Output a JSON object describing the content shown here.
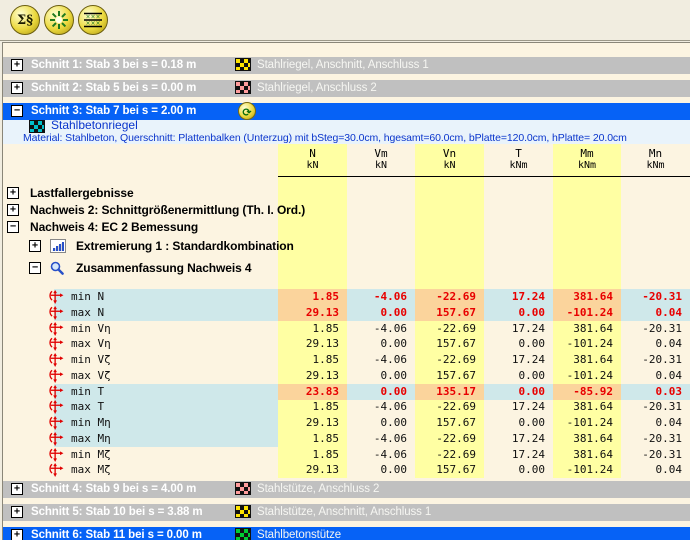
{
  "toolbar": {
    "buttons": [
      {
        "name": "sum-paragraph",
        "glyph": "Σ§"
      },
      {
        "name": "starburst",
        "glyph": ""
      },
      {
        "name": "value-table",
        "glyph": ""
      }
    ]
  },
  "sections": [
    {
      "label": "Schnitt 1: Stab 3 bei s = 0.18 m",
      "description": "Stahlriegel, Anschnitt, Anschluss 1",
      "checker": "yellow",
      "expanded": false,
      "selected": false
    },
    {
      "label": "Schnitt 2: Stab 5 bei s = 0.00 m",
      "description": "Stahlriegel, Anschluss 2",
      "checker": "pink",
      "expanded": false,
      "selected": false
    },
    {
      "label": "Schnitt 3: Stab 7 bei s = 2.00 m",
      "description": "",
      "checker": "none",
      "expanded": true,
      "selected": true
    },
    {
      "label": "Schnitt 4: Stab 9 bei s = 4.00 m",
      "description": "Stahlstütze, Anschluss 2",
      "checker": "pink",
      "expanded": false,
      "selected": false
    },
    {
      "label": "Schnitt 5: Stab 10 bei s = 3.88 m",
      "description": "Stahlstütze, Anschnitt, Anschluss 1",
      "checker": "yellow",
      "expanded": false,
      "selected": false
    },
    {
      "label": "Schnitt 6: Stab 11 bei s = 0.00 m",
      "description": "Stahlbetonstütze",
      "checker": "green",
      "expanded": false,
      "selected": true
    }
  ],
  "detail": {
    "member_label": "Stahlbetonriegel",
    "member_checker": "cyan",
    "material_line": "Material: Stahlbeton,  Querschnitt: Plattenbalken (Unterzug) mit bSteg=30.0cm, hgesamt=60.0cm, bPlatte=120.0cm, hPlatte= 20.0cm"
  },
  "tree": [
    {
      "label": "Lastfallergebnisse",
      "level": 0,
      "expanded": false,
      "icon": "none"
    },
    {
      "label": "Nachweis 2: Schnittgrößenermittlung (Th. I. Ord.)",
      "level": 0,
      "expanded": false,
      "icon": "none"
    },
    {
      "label": "Nachweis 4: EC 2 Bemessung",
      "level": 0,
      "expanded": true,
      "icon": "none"
    },
    {
      "label": "Extremierung 1 : Standardkombination",
      "level": 1,
      "expanded": false,
      "icon": "bar-chart"
    },
    {
      "label": "Zusammenfassung Nachweis 4",
      "level": 1,
      "expanded": true,
      "icon": "magnifier"
    }
  ],
  "table": {
    "columns": [
      {
        "name": "N",
        "unit": "kN",
        "band": true
      },
      {
        "name": "Vm",
        "unit": "kN",
        "band": false
      },
      {
        "name": "Vn",
        "unit": "kN",
        "band": true
      },
      {
        "name": "T",
        "unit": "kNm",
        "band": false
      },
      {
        "name": "Mm",
        "unit": "kNm",
        "band": true
      },
      {
        "name": "Mn",
        "unit": "kNm",
        "band": false
      }
    ],
    "rows": [
      {
        "label": "min N",
        "values": [
          "1.85",
          "-4.06",
          "-22.69",
          "17.24",
          "381.64",
          "-20.31"
        ],
        "highlight": "row"
      },
      {
        "label": "max N",
        "values": [
          "29.13",
          "0.00",
          "157.67",
          "0.00",
          "-101.24",
          "0.04"
        ],
        "highlight": "row"
      },
      {
        "label": "min Vη",
        "values": [
          "1.85",
          "-4.06",
          "-22.69",
          "17.24",
          "381.64",
          "-20.31"
        ],
        "highlight": "none"
      },
      {
        "label": "max Vη",
        "values": [
          "29.13",
          "0.00",
          "157.67",
          "0.00",
          "-101.24",
          "0.04"
        ],
        "highlight": "none"
      },
      {
        "label": "min Vζ",
        "values": [
          "1.85",
          "-4.06",
          "-22.69",
          "17.24",
          "381.64",
          "-20.31"
        ],
        "highlight": "none"
      },
      {
        "label": "max Vζ",
        "values": [
          "29.13",
          "0.00",
          "157.67",
          "0.00",
          "-101.24",
          "0.04"
        ],
        "highlight": "none"
      },
      {
        "label": "min T",
        "values": [
          "23.83",
          "0.00",
          "135.17",
          "0.00",
          "-85.92",
          "0.03"
        ],
        "highlight": "row"
      },
      {
        "label": "max T",
        "values": [
          "1.85",
          "-4.06",
          "-22.69",
          "17.24",
          "381.64",
          "-20.31"
        ],
        "highlight": "label"
      },
      {
        "label": "min Mη",
        "values": [
          "29.13",
          "0.00",
          "157.67",
          "0.00",
          "-101.24",
          "0.04"
        ],
        "highlight": "label"
      },
      {
        "label": "max Mη",
        "values": [
          "1.85",
          "-4.06",
          "-22.69",
          "17.24",
          "381.64",
          "-20.31"
        ],
        "highlight": "label"
      },
      {
        "label": "min Mζ",
        "values": [
          "1.85",
          "-4.06",
          "-22.69",
          "17.24",
          "381.64",
          "-20.31"
        ],
        "highlight": "none"
      },
      {
        "label": "max Mζ",
        "values": [
          "29.13",
          "0.00",
          "157.67",
          "0.00",
          "-101.24",
          "0.04"
        ],
        "highlight": "none"
      }
    ]
  },
  "colors": {
    "panel_cream": "#fcf4e1",
    "toolbar_cream": "#f1ede0",
    "bar_gray": "#c0c0c0",
    "selection_blue": "#0662f6",
    "info_bg": "#e9f3fb",
    "info_text": "#0a35cc",
    "band_yellow": "#ffffa3",
    "highlight_cyan": "#cfe8ea",
    "highlight_orange": "#fbd49c",
    "value_red": "#e80000"
  }
}
